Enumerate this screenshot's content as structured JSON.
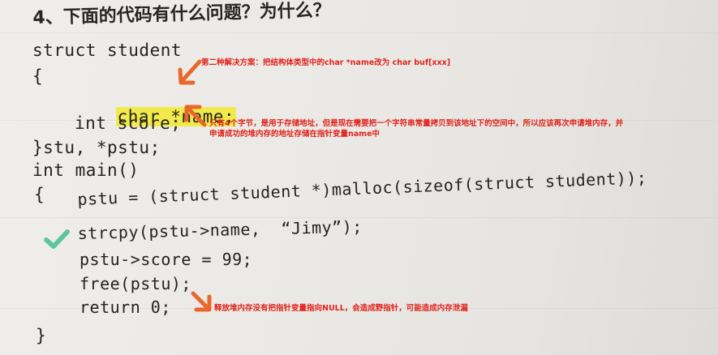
{
  "question": {
    "title": "4、下面的代码有什么问题？为什么？"
  },
  "code": {
    "lines": [
      "struct student",
      "{",
      "char *name;",
      "int score;",
      "}stu, *pstu;",
      "int main()",
      "{",
      "pstu = (struct student *)malloc(sizeof(struct student));",
      "strcpy(pstu->name,  “Jimy”);",
      "pstu->score = 99;",
      "free(pstu);",
      "return 0;",
      "}"
    ]
  },
  "annotations": {
    "solution_note": "第二种解决方案：把结构体类型中的char *name改为 char buf[xxx]",
    "pointer_note_line1": "只有4个字节，是用于存储地址，但是现在需要把一个字符串常量拷贝到该地址下的空间中，所以应该再次申请堆内存，并",
    "pointer_note_line2": "申请成功的堆内存的地址存储在指针变量name中",
    "free_note": "释放堆内存没有把指针变量指向NULL，会造成野指针，可能造成内存泄漏"
  },
  "colors": {
    "annotation_text": "#e0231b",
    "arrow": "#e9672a",
    "highlight": "#f2ea4a",
    "check": "#5fc5a0"
  },
  "icons": {
    "arrows": "orange-arrow-icon",
    "check": "check-mark-icon"
  }
}
